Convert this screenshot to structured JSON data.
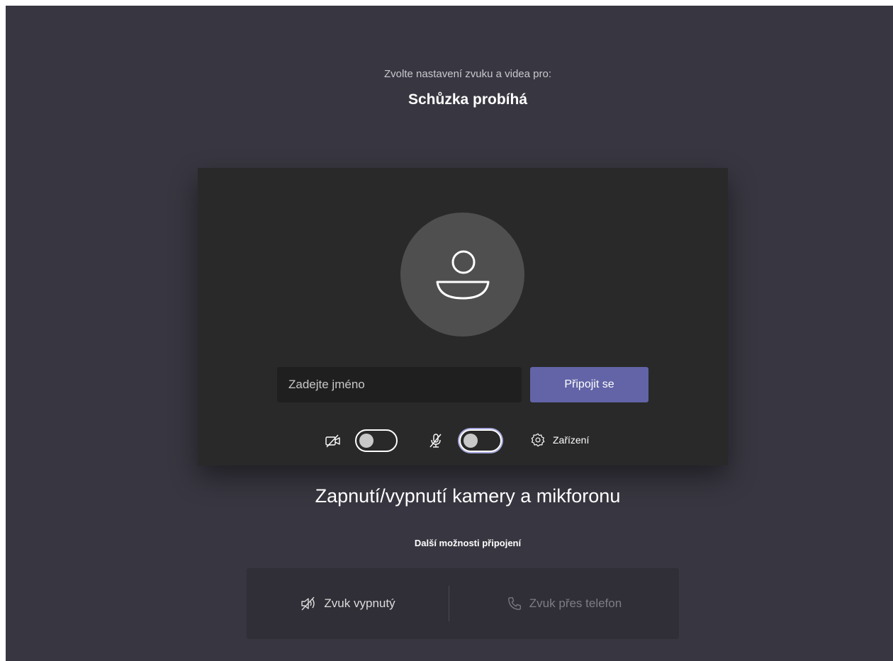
{
  "header": {
    "subtitle": "Zvolte nastavení zvuku a videa pro:",
    "meeting_title": "Schůzka probíhá"
  },
  "preview": {
    "avatar_icon": "person-icon",
    "name_placeholder": "Zadejte jméno",
    "join_label": "Připojit se",
    "camera_icon": "camera-off-icon",
    "camera_toggle": "off",
    "mic_icon": "mic-off-icon",
    "mic_toggle": "off",
    "devices_icon": "gear-icon",
    "devices_label": "Zařízení"
  },
  "caption": "Zapnutí/vypnutí kamery a mikforonu",
  "more_options": {
    "heading": "Další možnosti připojení",
    "audio_off_icon": "speaker-off-icon",
    "audio_off_label": "Zvuk vypnutý",
    "phone_icon": "phone-icon",
    "phone_label": "Zvuk přes telefon"
  },
  "colors": {
    "background": "#383741",
    "card": "#292929",
    "accent": "#6264a7",
    "toggle_focus": "#a6a7dc"
  }
}
